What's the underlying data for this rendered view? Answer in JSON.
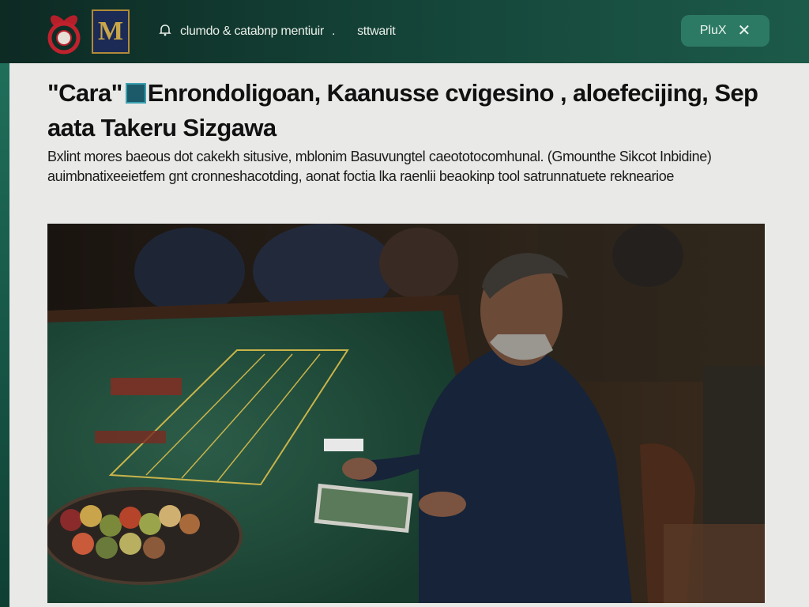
{
  "header": {
    "nav_links": [
      "clumdo & catabnp mentiuir",
      "sttwarit"
    ],
    "nav_separator": ".",
    "plus_button_label": "PluX",
    "close_icon_glyph": "✕",
    "logo_monogram": "M"
  },
  "article": {
    "title_prefix": "\"Cara\"",
    "title_rest": "Enrondoligoan, Kaanusse cvigesino , aloefecijing, Sep aata Takeru Sizgawa",
    "description": "Bxlint mores baeous dot cakekh situsive, mblonim Basuvungtel caeototocomhunal. (Gmounthe Sikcot Inbidine) auimbnatixeeietfem gnt cronneshacotding, aonat foctia lka raenlii beaokinp tool satrunnatuete reknearioe"
  },
  "colors": {
    "topbar": "#15463a",
    "panel": "#e9e9e7",
    "felt": "#1f4a3a",
    "accent_pill": "#2d7a64"
  },
  "icons": {
    "nav": "bell-icon",
    "close": "close-icon"
  }
}
